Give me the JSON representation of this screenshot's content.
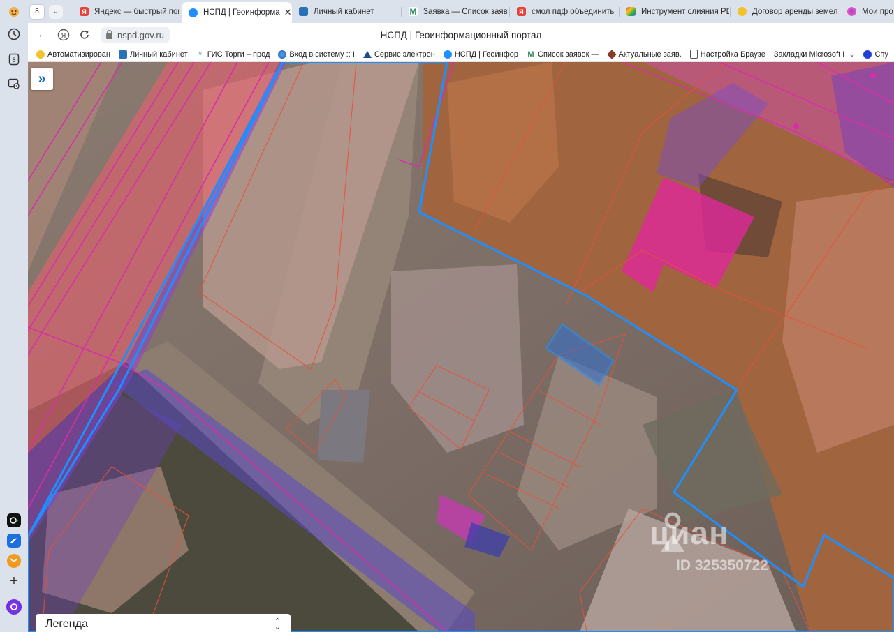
{
  "browser": {
    "tab_count": "8",
    "tabs": [
      {
        "title": "Яндекс — быстрый пои",
        "icon": "yandex-icon",
        "active": false
      },
      {
        "title": "НСПД | Геоинформа",
        "icon": "nspd-icon",
        "active": true
      },
      {
        "title": "Личный кабинет",
        "icon": "rosreestr-icon",
        "active": false
      },
      {
        "title": "Заявка — Список заявс",
        "icon": "m-icon",
        "active": false
      },
      {
        "title": "смол пдф объединить",
        "icon": "yandex-icon",
        "active": false
      },
      {
        "title": "Инструмент слияния PD",
        "icon": "colorful-icon",
        "active": false
      },
      {
        "title": "Договор аренды земел",
        "icon": "yellow-icon",
        "active": false
      },
      {
        "title": "Мои про",
        "icon": "alice-icon",
        "active": false
      }
    ],
    "close_glyph": "✕",
    "url": "nspd.gov.ru",
    "page_title": "НСПД | Геоинформационный портал",
    "bookmarks": [
      {
        "label": "Автоматизирован",
        "icon": "yellow-icon"
      },
      {
        "label": "Личный кабинет",
        "icon": "rosreestr-icon"
      },
      {
        "label": "ГИС Торги – прод",
        "icon": "emblem-icon"
      },
      {
        "label": "Вход в систему :: I",
        "icon": "globe-icon"
      },
      {
        "label": "Сервис электрон",
        "icon": "mountain-icon"
      },
      {
        "label": "НСПД | Геоинфор",
        "icon": "nspd-icon"
      },
      {
        "label": "Список заявок —",
        "icon": "m-icon"
      },
      {
        "label": "Актуальные заяв.",
        "icon": "cube-icon"
      },
      {
        "label": "Настройка Браузе",
        "icon": "page-icon"
      },
      {
        "label": "Закладки Microsoft I",
        "icon": "none"
      },
      {
        "label": "Спу",
        "icon": "blue-circle-icon"
      }
    ]
  },
  "map": {
    "expand_glyph": "»",
    "legend_label": "Легенда",
    "legend_toggle": "⌃⌄",
    "watermark": {
      "brand": "циан",
      "id": "ID 325350722"
    },
    "colors": {
      "parcel_outline": "#1e8fff",
      "cadastral_line": "#e8503a",
      "zone_magenta": "#d62fa8",
      "zone_purple": "#6d3cc9",
      "selected_fill": "#2f6fd6"
    }
  }
}
